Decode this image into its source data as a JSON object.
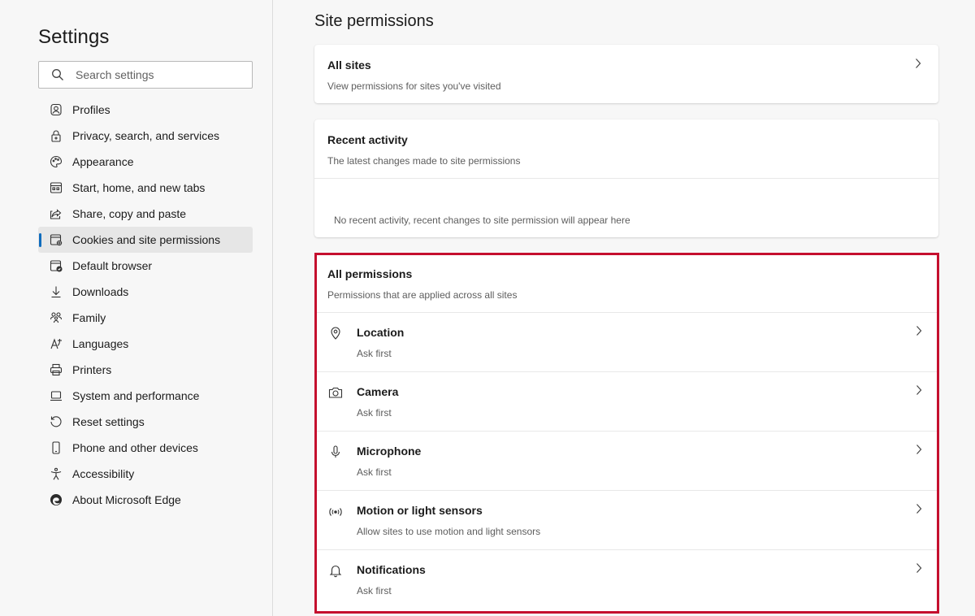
{
  "sidebar": {
    "title": "Settings",
    "search_placeholder": "Search settings",
    "items": [
      {
        "label": "Profiles",
        "icon": "profile-icon"
      },
      {
        "label": "Privacy, search, and services",
        "icon": "lock-icon"
      },
      {
        "label": "Appearance",
        "icon": "palette-icon"
      },
      {
        "label": "Start, home, and new tabs",
        "icon": "home-tabs-icon"
      },
      {
        "label": "Share, copy and paste",
        "icon": "share-icon"
      },
      {
        "label": "Cookies and site permissions",
        "icon": "cookies-icon",
        "active": true
      },
      {
        "label": "Default browser",
        "icon": "browser-icon"
      },
      {
        "label": "Downloads",
        "icon": "download-icon"
      },
      {
        "label": "Family",
        "icon": "family-icon"
      },
      {
        "label": "Languages",
        "icon": "languages-icon"
      },
      {
        "label": "Printers",
        "icon": "printer-icon"
      },
      {
        "label": "System and performance",
        "icon": "laptop-icon"
      },
      {
        "label": "Reset settings",
        "icon": "reset-icon"
      },
      {
        "label": "Phone and other devices",
        "icon": "phone-icon"
      },
      {
        "label": "Accessibility",
        "icon": "accessibility-icon"
      },
      {
        "label": "About Microsoft Edge",
        "icon": "edge-icon"
      }
    ]
  },
  "main": {
    "title": "Site permissions",
    "all_sites": {
      "title": "All sites",
      "subtitle": "View permissions for sites you've visited"
    },
    "recent_activity": {
      "title": "Recent activity",
      "subtitle": "The latest changes made to site permissions",
      "empty_message": "No recent activity, recent changes to site permission will appear here"
    },
    "all_permissions": {
      "title": "All permissions",
      "subtitle": "Permissions that are applied across all sites",
      "items": [
        {
          "title": "Location",
          "subtitle": "Ask first",
          "icon": "location-pin-icon"
        },
        {
          "title": "Camera",
          "subtitle": "Ask first",
          "icon": "camera-icon"
        },
        {
          "title": "Microphone",
          "subtitle": "Ask first",
          "icon": "microphone-icon"
        },
        {
          "title": "Motion or light sensors",
          "subtitle": "Allow sites to use motion and light sensors",
          "icon": "sensor-icon"
        },
        {
          "title": "Notifications",
          "subtitle": "Ask first",
          "icon": "bell-icon"
        }
      ]
    }
  },
  "colors": {
    "accent": "#0f6cbd",
    "highlight_border": "#c50f2e",
    "active_nav_bg": "#e6e6e6"
  }
}
